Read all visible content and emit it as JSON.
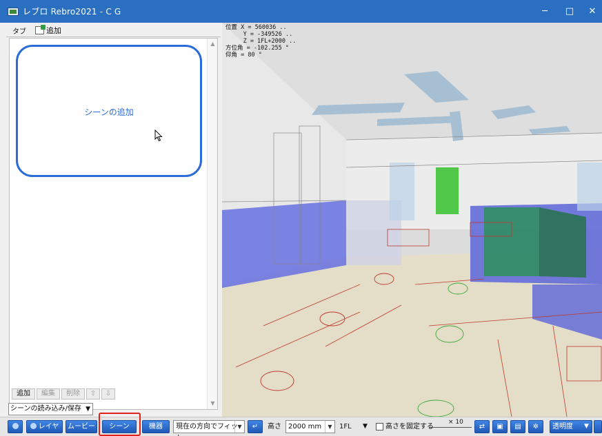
{
  "window": {
    "title": "レブロ Rebro2021 - C G",
    "controls": {
      "minimize": "─",
      "maximize": "□",
      "close": "✕"
    }
  },
  "left_panel": {
    "tab_label": "タブ",
    "add_tab_label": "追加",
    "scene_card_text": "シーンの追加",
    "list_buttons": {
      "add": "追加",
      "edit": "編集",
      "delete": "削除",
      "up": "⇧",
      "down": "⇩"
    },
    "load_save_label": "シーンの読み込み/保存",
    "load_save_arrow": "▼"
  },
  "viewport": {
    "coords": "位置 X = 560036 ..\n     Y = -349526 ..\n     Z = 1FL+2000 ..\n方位角 = -102.255 °\n仰角 = 80 °"
  },
  "toolbar": {
    "layer_label": "レイヤー",
    "movie_label": "ムービー",
    "scene_label": "シーン",
    "equipment_label": "機器",
    "fit_combo": "現在の方向でフィット",
    "height_label": "高さ",
    "height_value": "2000 mm",
    "floor_value": "1FL",
    "fix_height_label": "高さを固定する",
    "speed_label": "× 10",
    "transparency_label": "透明度"
  },
  "colors": {
    "title_bar": "#2b6fc0",
    "accent_blue": "#2a6bd9",
    "highlight_red": "#e0201a"
  }
}
